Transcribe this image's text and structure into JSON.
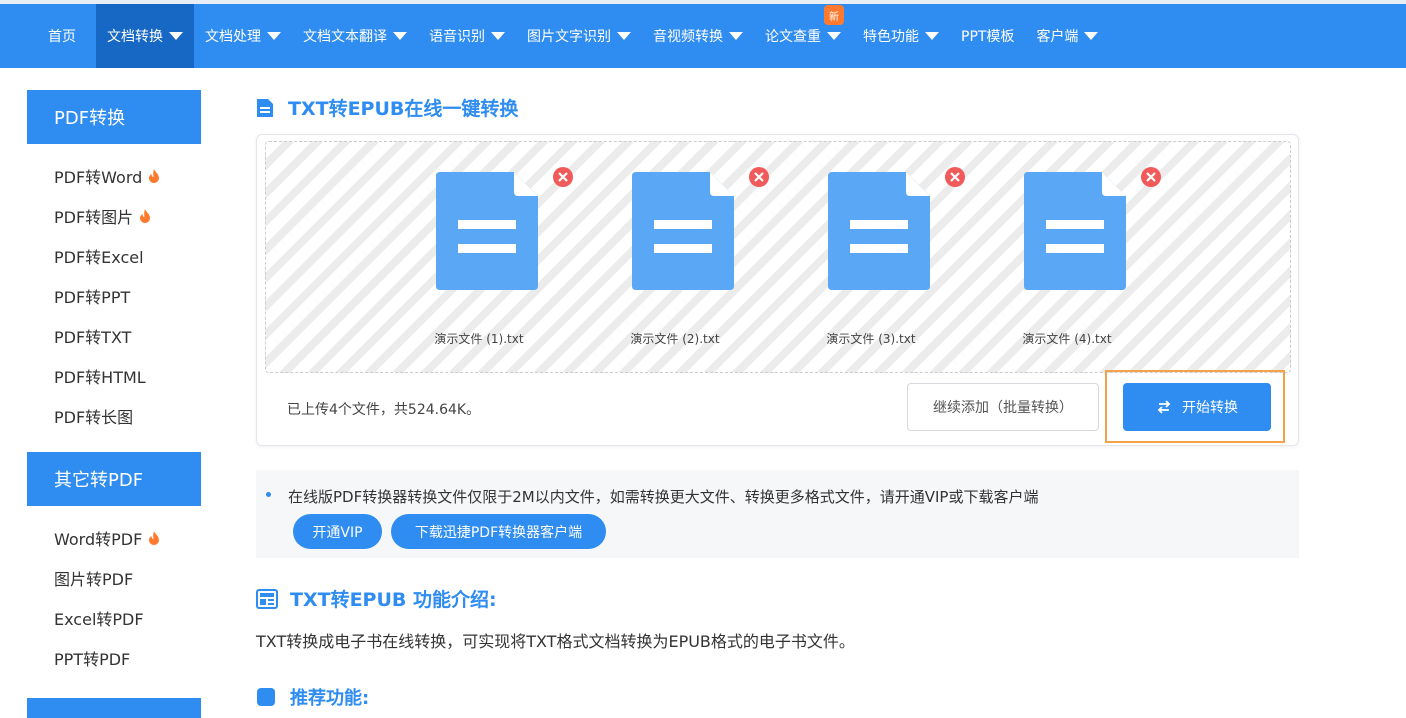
{
  "nav": {
    "items": [
      {
        "label": "首页",
        "caret": false
      },
      {
        "label": "文档转换",
        "caret": true,
        "active": true
      },
      {
        "label": "文档处理",
        "caret": true
      },
      {
        "label": "文档文本翻译",
        "caret": true
      },
      {
        "label": "语音识别",
        "caret": true
      },
      {
        "label": "图片文字识别",
        "caret": true
      },
      {
        "label": "音视频转换",
        "caret": true
      },
      {
        "label": "论文查重",
        "caret": true,
        "badge": "新"
      },
      {
        "label": "特色功能",
        "caret": true
      },
      {
        "label": "PPT模板",
        "caret": false
      },
      {
        "label": "客户端",
        "caret": true
      }
    ]
  },
  "sidebar": {
    "group1_title": "PDF转换",
    "group1_items": [
      {
        "label": "PDF转Word",
        "hot": true
      },
      {
        "label": "PDF转图片",
        "hot": true
      },
      {
        "label": "PDF转Excel",
        "hot": false
      },
      {
        "label": "PDF转PPT",
        "hot": false
      },
      {
        "label": "PDF转TXT",
        "hot": false
      },
      {
        "label": "PDF转HTML",
        "hot": false
      },
      {
        "label": "PDF转长图",
        "hot": false
      }
    ],
    "group2_title": "其它转PDF",
    "group2_items": [
      {
        "label": "Word转PDF",
        "hot": true
      },
      {
        "label": "图片转PDF",
        "hot": false
      },
      {
        "label": "Excel转PDF",
        "hot": false
      },
      {
        "label": "PPT转PDF",
        "hot": false
      }
    ]
  },
  "main": {
    "title": "TXT转EPUB在线一键转换",
    "files": [
      "演示文件 (1).txt",
      "演示文件 (2).txt",
      "演示文件 (3).txt",
      "演示文件 (4).txt"
    ],
    "upload_summary": "已上传4个文件，共524.64K。",
    "add_button": "继续添加（批量转换）",
    "start_button": "开始转换",
    "notice_text": "在线版PDF转换器转换文件仅限于2M以内文件，如需转换更大文件、转换更多格式文件，请开通VIP或下载客户端",
    "vip_button": "开通VIP",
    "download_button": "下载迅捷PDF转换器客户端",
    "intro_title": "TXT转EPUB 功能介绍:",
    "intro_desc": "TXT转换成电子书在线转换，可实现将TXT格式文档转换为EPUB格式的电子书文件。",
    "recommend_title": "推荐功能:"
  },
  "colors": {
    "brand_blue": "#2f8cf0",
    "nav_active": "#1767c4",
    "highlight_orange": "#f5a04b",
    "remove_red": "#f05a5a",
    "hot_orange": "#ff7a2e"
  }
}
